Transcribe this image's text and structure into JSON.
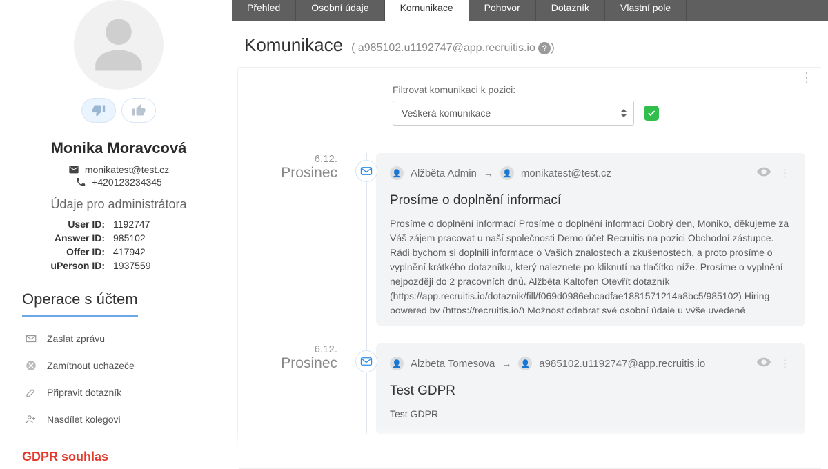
{
  "candidate": {
    "name": "Monika Moravcová",
    "email": "monikatest@test.cz",
    "phone": "+420123234345",
    "admin_section_title": "Údaje pro administrátora",
    "ids": {
      "user_id_label": "User ID:",
      "user_id": "1192747",
      "answer_id_label": "Answer ID:",
      "answer_id": "985102",
      "offer_id_label": "Offer ID:",
      "offer_id": "417942",
      "uperson_id_label": "uPerson ID:",
      "uperson_id": "1937559"
    },
    "ops_title": "Operace s účtem",
    "ops": {
      "send_message": "Zaslat zprávu",
      "reject": "Zamítnout uchazeče",
      "prepare_questionnaire": "Připravit dotazník",
      "share": "Nasdílet kolegovi"
    }
  },
  "tabs": {
    "overview": "Přehled",
    "personal": "Osobní údaje",
    "communication": "Komunikace",
    "interview": "Pohovor",
    "questionnaire": "Dotazník",
    "custom": "Vlastní pole"
  },
  "page": {
    "title": "Komunikace",
    "sub_prefix": "( ",
    "generated_email": "a985102.u1192747@app.recruitis.io",
    "sub_suffix": ")"
  },
  "filter": {
    "label": "Filtrovat komunikaci k pozici:",
    "value": "Veškerá komunikace"
  },
  "messages": [
    {
      "date_short": "6.12.",
      "date_month": "Prosinec",
      "from_name": "Alžběta Admin",
      "to_email": "monikatest@test.cz",
      "subject": "Prosíme o doplnění informací",
      "body": "Prosíme o doplnění informací Prosíme o doplnění informací Dobrý den, Moniko, děkujeme za Váš zájem pracovat u naší společnosti Demo účet Recruitis na pozici Obchodní zástupce. Rádi bychom si doplnili informace o Vašich znalostech a zkušenostech, a proto prosíme o vyplnění krátkého dotazníku, který naleznete po kliknutí na tlačítko níže. Prosíme o vyplnění nejpozději do 2 pracovních dnů. Alžběta Kaltofen Otevřít dotazník (https://app.recruitis.io/dotaznik/fill/f069d0986ebcadfae1881571214a8bc5/985102) Hiring powered by (https://recruitis.io/) Možnost odebrat své osobní údaje u výše uvedené společnosti spravujte kliknutím zde."
    },
    {
      "date_short": "6.12.",
      "date_month": "Prosinec",
      "from_name": "Alzbeta Tomesova",
      "to_email": "a985102.u1192747@app.recruitis.io",
      "subject": "Test GDPR",
      "body": "Test GDPR"
    }
  ],
  "gdpr_label": "GDPR souhlas"
}
